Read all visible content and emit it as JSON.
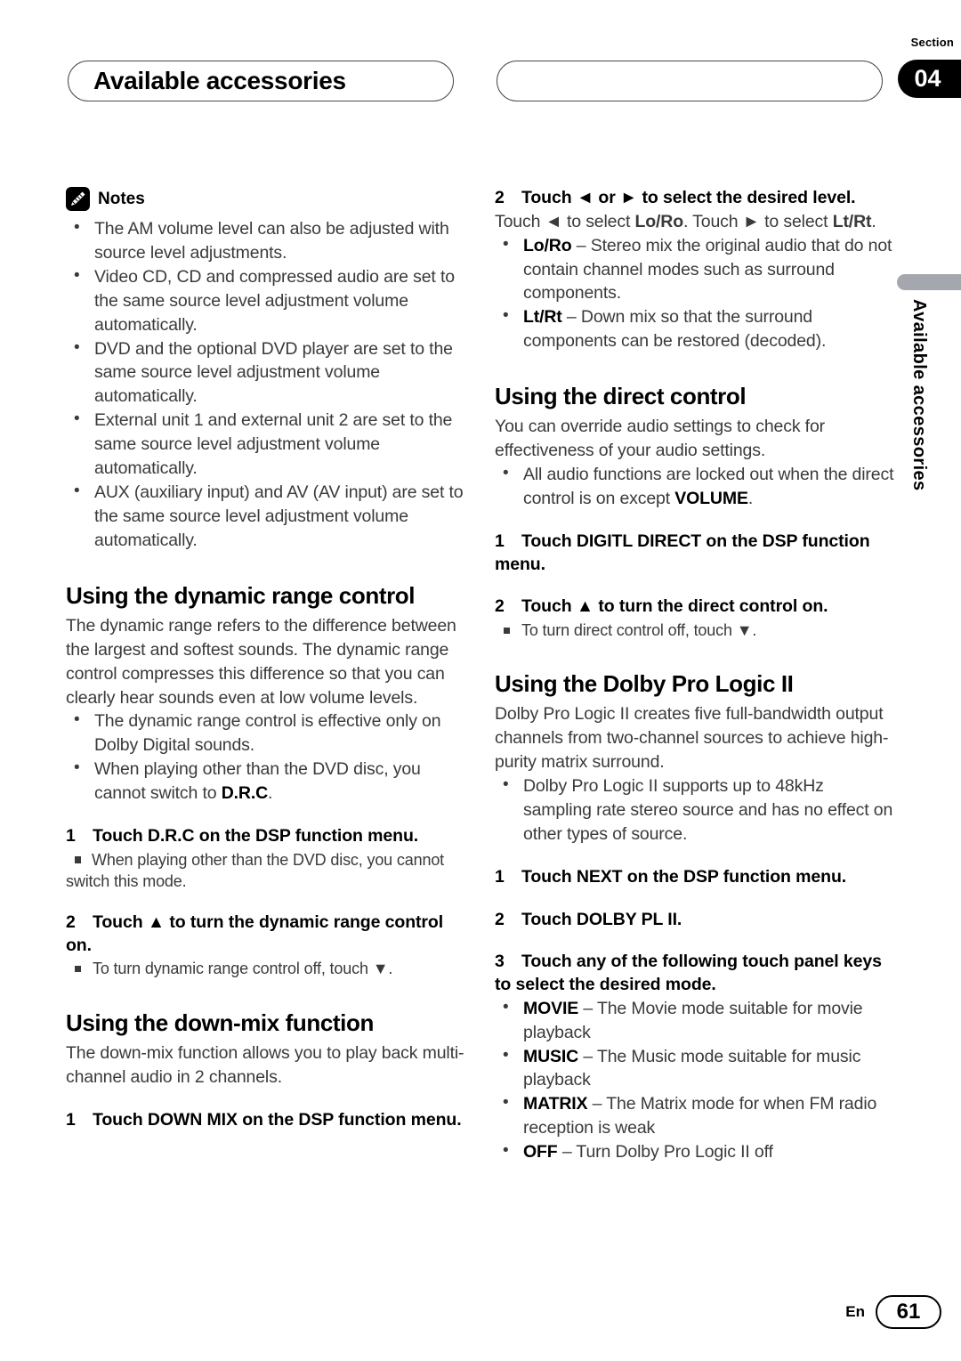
{
  "header": {
    "title": "Available accessories",
    "section_label": "Section",
    "section_number": "04"
  },
  "side_tab": {
    "text": "Available accessories"
  },
  "left_column": {
    "notes": {
      "icon": "pencil-note-icon",
      "label": "Notes",
      "items": [
        "The AM volume level can also be adjusted with source level adjustments.",
        "Video CD, CD and compressed audio are set to the same source level adjustment volume automatically.",
        "DVD and the optional DVD player are set to the same source level adjustment volume automatically.",
        "External unit 1 and external unit 2 are set to the same source level adjustment volume automatically.",
        "AUX (auxiliary input) and AV (AV input) are set to the same source level adjustment volume automatically."
      ]
    },
    "dynamic_range": {
      "heading": "Using the dynamic range control",
      "intro": "The dynamic range refers to the difference between the largest and softest sounds. The dynamic range control compresses this difference so that you can clearly hear sounds even at low volume levels.",
      "bullets": [
        "The dynamic range control is effective only on Dolby Digital sounds.",
        "When playing other than the DVD disc, you cannot switch to D.R.C."
      ],
      "step1_num": "1",
      "step1_text": "Touch D.R.C on the DSP function menu.",
      "step1_note": "When playing other than the DVD disc, you cannot switch this mode.",
      "step2_num": "2",
      "step2_text": "Touch ▲ to turn the dynamic range control on.",
      "step2_note": "To turn dynamic range control off, touch ▼."
    },
    "down_mix": {
      "heading": "Using the down-mix function",
      "intro": "The down-mix function allows you to play back multi-channel audio in 2 channels.",
      "step1_num": "1",
      "step1_text": "Touch DOWN MIX on the DSP function menu."
    }
  },
  "right_column": {
    "down_mix_cont": {
      "step2_num": "2",
      "step2_text": "Touch ◄ or ► to select the desired level.",
      "step2_desc_a": "Touch ◄ to select ",
      "step2_desc_b": "Lo/Ro",
      "step2_desc_c": ". Touch ► to select ",
      "step2_desc_d": "Lt/Rt",
      "step2_desc_e": ".",
      "bullets": [
        {
          "term": "Lo/Ro",
          "desc": " – Stereo mix the original audio that do not contain channel modes such as surround components."
        },
        {
          "term": "Lt/Rt",
          "desc": " – Down mix so that the surround components can be restored (decoded)."
        }
      ]
    },
    "direct_control": {
      "heading": "Using the direct control",
      "intro": "You can override audio settings to check for effectiveness of your audio settings.",
      "bullets": [
        "All audio functions are locked out when the direct control is on except VOLUME."
      ],
      "step1_num": "1",
      "step1_text": "Touch DIGITL DIRECT on the DSP function menu.",
      "step2_num": "2",
      "step2_text": "Touch ▲ to turn the direct control on.",
      "step2_note": "To turn direct control off, touch ▼."
    },
    "dolby_pro_logic": {
      "heading": "Using the Dolby Pro Logic II",
      "intro": "Dolby Pro Logic II creates five full-bandwidth output channels from two-channel sources to achieve high-purity matrix surround.",
      "bullets": [
        "Dolby Pro Logic II supports up to 48kHz sampling rate stereo source and has no effect on other types of source."
      ],
      "step1_num": "1",
      "step1_text": "Touch NEXT on the DSP function menu.",
      "step2_num": "2",
      "step2_text": "Touch DOLBY PL II.",
      "step3_num": "3",
      "step3_text": "Touch any of the following touch panel keys to select the desired mode.",
      "modes": [
        {
          "term": "MOVIE",
          "desc": " – The Movie mode suitable for movie playback"
        },
        {
          "term": "MUSIC",
          "desc": " – The Music mode suitable for music playback"
        },
        {
          "term": "MATRIX",
          "desc": " – The Matrix mode for when FM radio reception is weak"
        },
        {
          "term": "OFF",
          "desc": " – Turn Dolby Pro Logic II off"
        }
      ]
    }
  },
  "footer": {
    "language": "En",
    "page_number": "61"
  }
}
